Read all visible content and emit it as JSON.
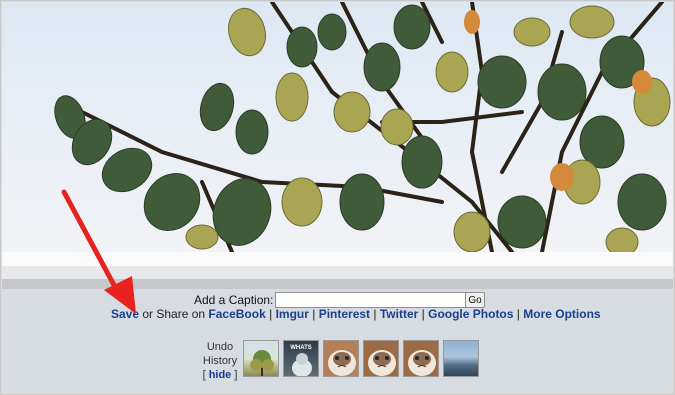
{
  "caption": {
    "label": "Add a Caption:",
    "input_value": "",
    "go_label": "Go"
  },
  "share": {
    "save": "Save",
    "text": " or Share on ",
    "links": [
      "FaceBook",
      "Imgur",
      "Pinterest",
      "Twitter",
      "Google Photos",
      "More Options"
    ],
    "separator": " | "
  },
  "undo": {
    "line1": "Undo",
    "line2": "History",
    "bracket_open": "[ ",
    "hide": "hide",
    "bracket_close": " ]"
  },
  "thumbnails": [
    {
      "name": "tree-thumbnail",
      "caption": ""
    },
    {
      "name": "meme-thumbnail",
      "caption": "WHATS"
    },
    {
      "name": "grumpy-cat-thumbnail-1",
      "caption": ""
    },
    {
      "name": "grumpy-cat-thumbnail-2",
      "caption": ""
    },
    {
      "name": "grumpy-cat-thumbnail-3",
      "caption": ""
    },
    {
      "name": "landscape-thumbnail",
      "caption": ""
    }
  ],
  "colors": {
    "link": "#1a3f8c",
    "background": "#d7dce3",
    "arrow": "#e8231f"
  }
}
